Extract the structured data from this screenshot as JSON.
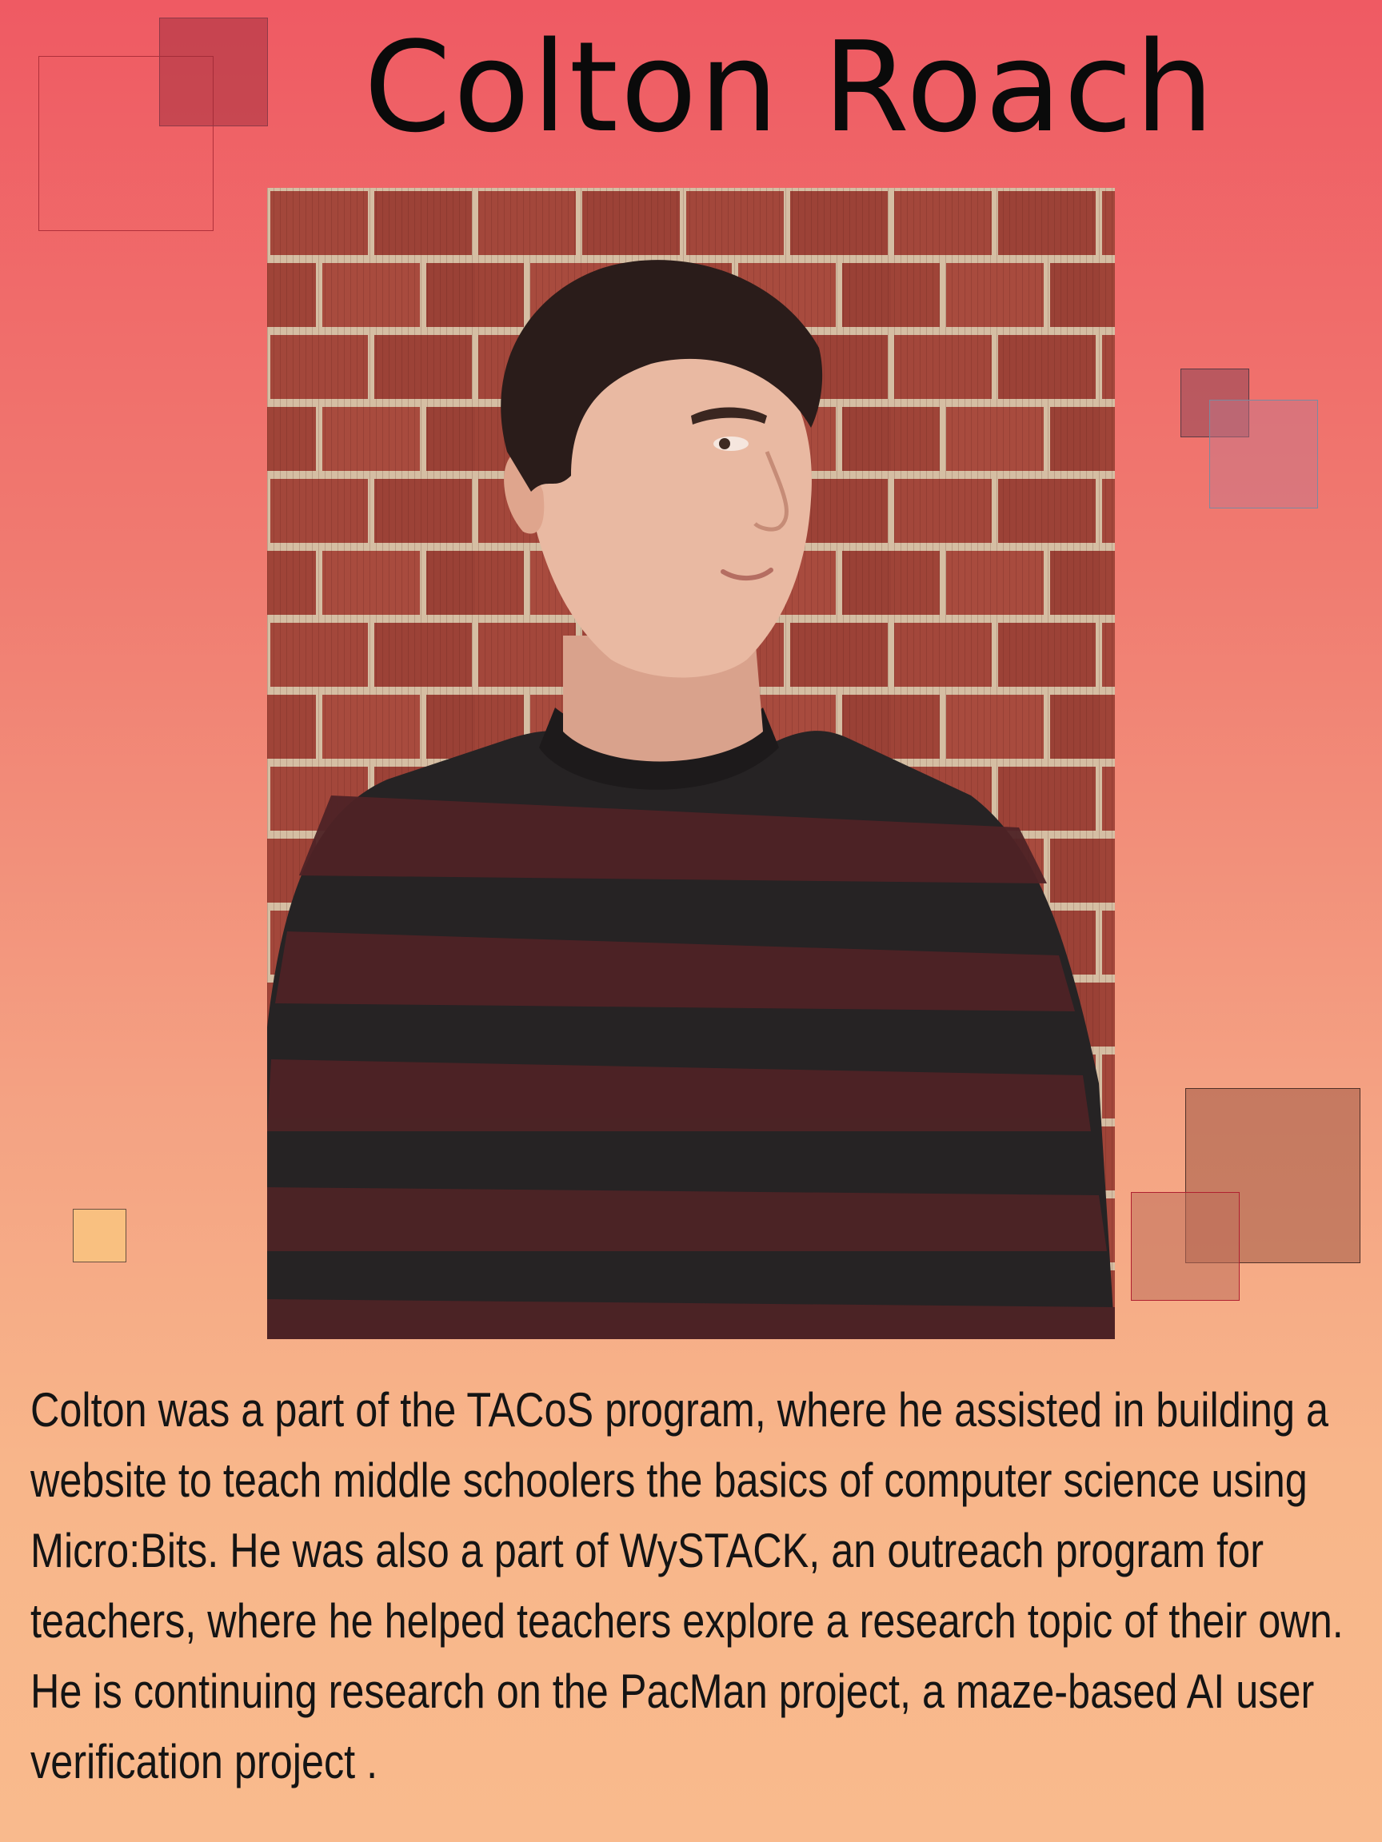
{
  "profile": {
    "name": "Colton Roach",
    "bio": "Colton was a part of the TACoS program, where he assisted in building a website to teach middle schoolers the basics of computer science using Micro:Bits. He was also a part of WySTACK, an outreach program for teachers, where he helped teachers explore a research topic of their own. He is continuing research on the PacMan project, a maze-based AI user verification project ."
  },
  "colors": {
    "background_top": "#ef5a63",
    "background_bottom": "#f9ba8d",
    "text": "#141414",
    "brick": "#a5493c",
    "mortar": "#d9c2a8",
    "sweater_dark": "#262324",
    "sweater_stripe": "#4e2326",
    "hair": "#2a1c1a",
    "skin": "#e9b9a2"
  }
}
